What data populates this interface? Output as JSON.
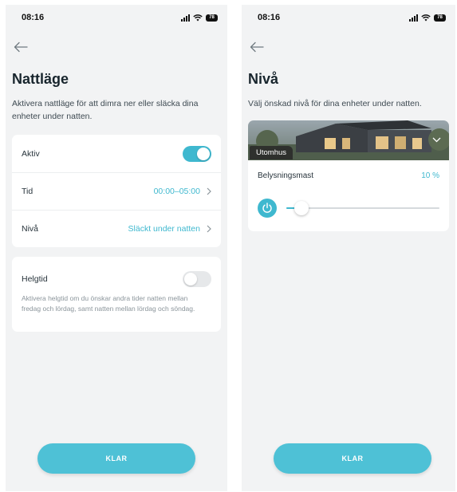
{
  "colors": {
    "accent": "#3fb8cf",
    "button": "#4ec1d6",
    "background": "#f2f3f4"
  },
  "status_bar": {
    "time": "08:16",
    "battery": "78",
    "icons": [
      "signal-icon",
      "wifi-icon",
      "battery-icon"
    ]
  },
  "left_screen": {
    "title": "Nattläge",
    "description": "Aktivera nattläge för att dimra ner eller släcka dina enheter under natten.",
    "settings": {
      "active": {
        "label": "Aktiv",
        "enabled": true
      },
      "time": {
        "label": "Tid",
        "value": "00:00–05:00"
      },
      "level": {
        "label": "Nivå",
        "value": "Släckt under natten"
      }
    },
    "weekend": {
      "title": "Helgtid",
      "enabled": false,
      "description": "Aktivera helgtid om du önskar andra tider natten mellan fredag och lördag, samt natten mellan lördag och söndag."
    },
    "button_label": "KLAR"
  },
  "right_screen": {
    "title": "Nivå",
    "description": "Välj önskad nivå för dina enheter under natten.",
    "group": {
      "label": "Utomhus",
      "device_name": "Belysningsmast",
      "level_text": "10 %",
      "level": 0.1
    },
    "button_label": "KLAR"
  }
}
